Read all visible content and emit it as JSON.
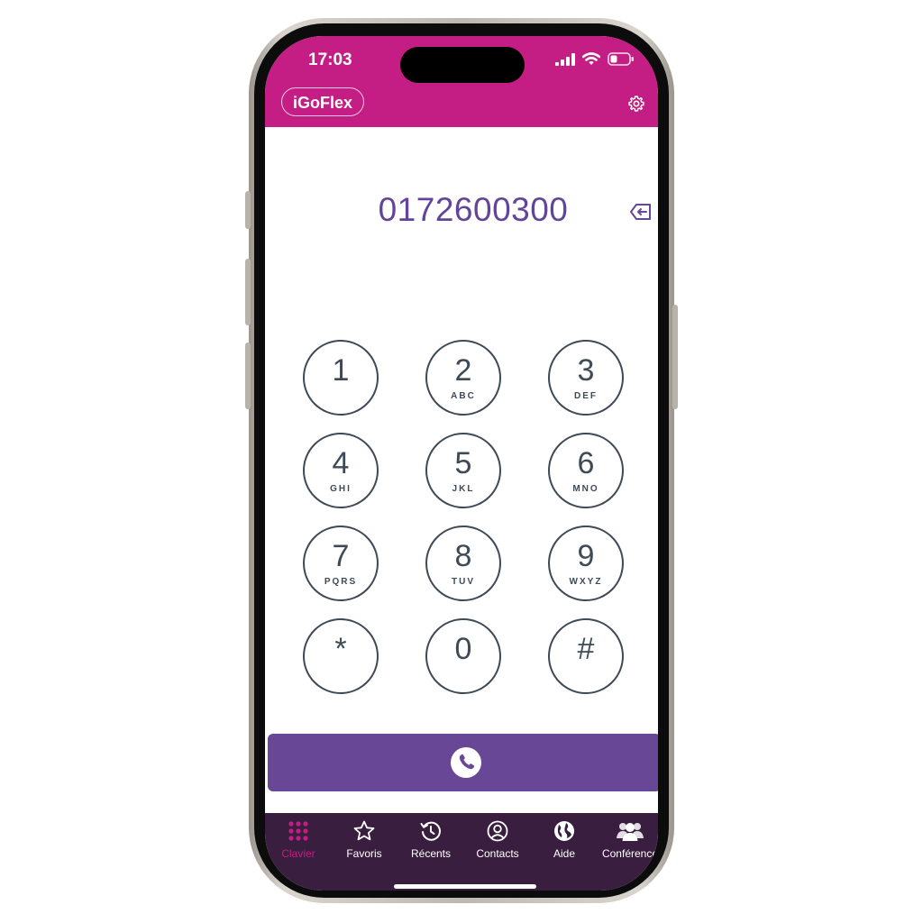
{
  "status_bar": {
    "time": "17:03"
  },
  "header": {
    "brand_label": "iGoFlex",
    "settings_icon": "gear-icon"
  },
  "dialer": {
    "number": "0172600300",
    "backspace_icon": "backspace-icon"
  },
  "keypad": [
    {
      "digit": "1",
      "letters": ""
    },
    {
      "digit": "2",
      "letters": "ABC"
    },
    {
      "digit": "3",
      "letters": "DEF"
    },
    {
      "digit": "4",
      "letters": "GHI"
    },
    {
      "digit": "5",
      "letters": "JKL"
    },
    {
      "digit": "6",
      "letters": "MNO"
    },
    {
      "digit": "7",
      "letters": "PQRS"
    },
    {
      "digit": "8",
      "letters": "TUV"
    },
    {
      "digit": "9",
      "letters": "WXYZ"
    },
    {
      "digit": "*",
      "letters": ""
    },
    {
      "digit": "0",
      "letters": ""
    },
    {
      "digit": "#",
      "letters": ""
    }
  ],
  "call_button": {
    "icon": "phone-icon"
  },
  "tabs": [
    {
      "label": "Clavier",
      "icon": "keypad-icon",
      "active": true
    },
    {
      "label": "Favoris",
      "icon": "star-icon",
      "active": false
    },
    {
      "label": "Récents",
      "icon": "history-icon",
      "active": false
    },
    {
      "label": "Contacts",
      "icon": "contact-icon",
      "active": false
    },
    {
      "label": "Aide",
      "icon": "globe-icon",
      "active": false
    },
    {
      "label": "Conférence",
      "icon": "group-icon",
      "active": false
    }
  ],
  "colors": {
    "header": "#c41d83",
    "accent_purple": "#674796",
    "number_text": "#62459b",
    "tabbar": "#3a1e3f",
    "key_stroke": "#3e4a56"
  }
}
